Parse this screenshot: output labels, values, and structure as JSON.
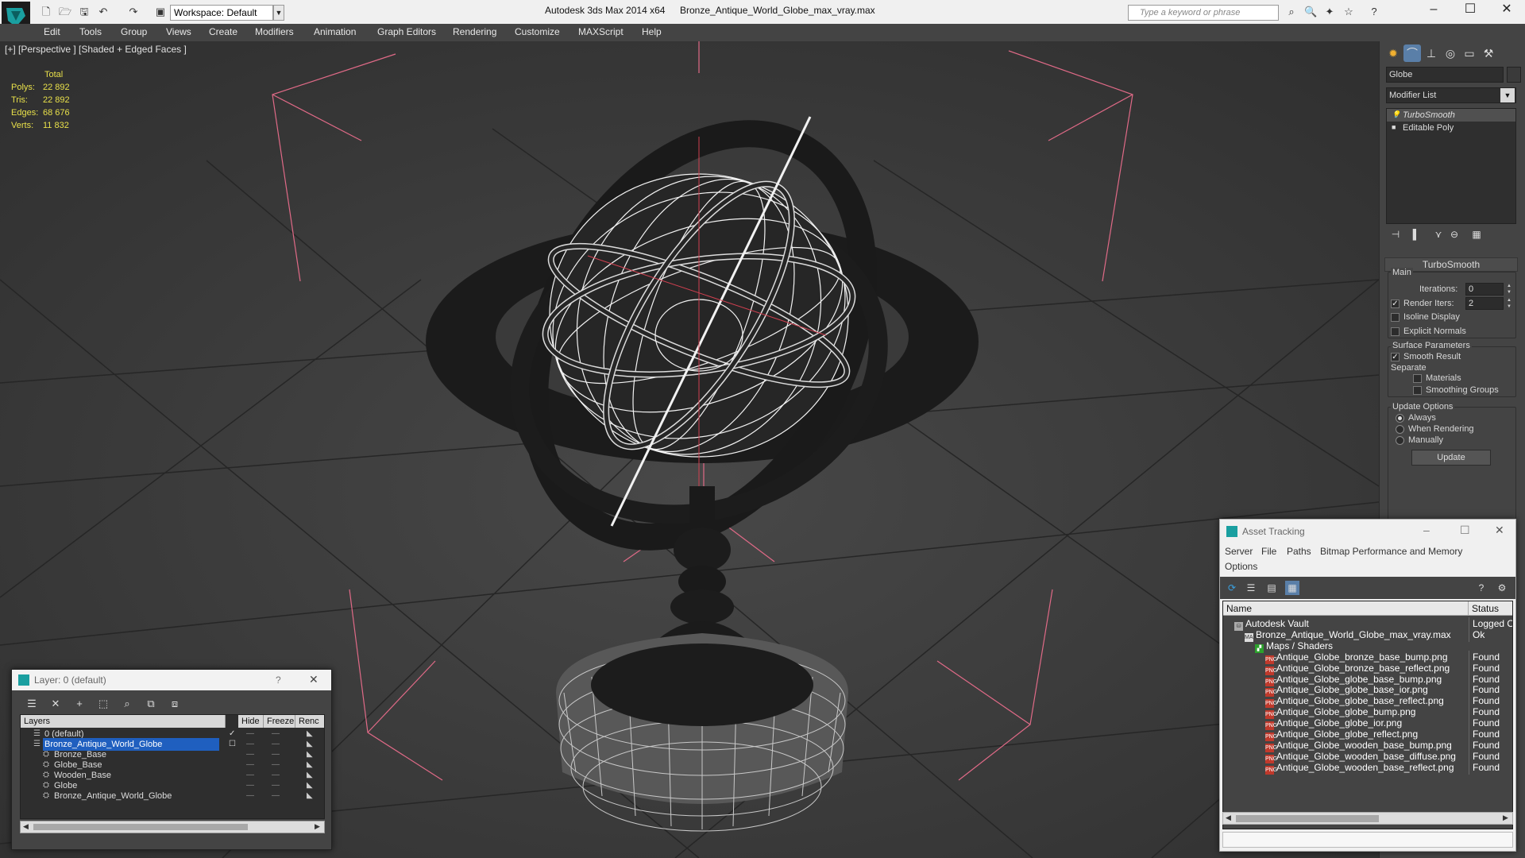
{
  "titlebar": {
    "workspace": "Workspace: Default",
    "app_title": "Autodesk 3ds Max  2014 x64",
    "file_title": "Bronze_Antique_World_Globe_max_vray.max",
    "search_placeholder": "Type a keyword or phrase"
  },
  "menu": [
    "Edit",
    "Tools",
    "Group",
    "Views",
    "Create",
    "Modifiers",
    "Animation",
    "Graph Editors",
    "Rendering",
    "Customize",
    "MAXScript",
    "Help"
  ],
  "viewport": {
    "label": "[+] [Perspective ] [Shaded + Edged Faces ]",
    "stats": {
      "header": "Total",
      "rows": [
        {
          "label": "Polys:",
          "value": "22 892"
        },
        {
          "label": "Tris:",
          "value": "22 892"
        },
        {
          "label": "Edges:",
          "value": "68 676"
        },
        {
          "label": "Verts:",
          "value": "11 832"
        }
      ]
    }
  },
  "command_panel": {
    "object_name": "Globe",
    "modifier_list": "Modifier List",
    "stack": [
      "TurboSmooth",
      "Editable Poly"
    ],
    "rollout": "TurboSmooth",
    "main_label": "Main",
    "iterations_label": "Iterations:",
    "iterations": "0",
    "render_iters_label": "Render Iters:",
    "render_iters": "2",
    "isoline": "Isoline Display",
    "explicit_normals": "Explicit Normals",
    "surface_params": "Surface Parameters",
    "smooth_result": "Smooth Result",
    "separate": "Separate",
    "materials": "Materials",
    "smoothing_groups": "Smoothing Groups",
    "update_options": "Update Options",
    "always": "Always",
    "when_rendering": "When Rendering",
    "manually": "Manually",
    "update_button": "Update"
  },
  "layer_dialog": {
    "title": "Layer: 0 (default)",
    "help": "?",
    "columns": [
      "Layers",
      "Hide",
      "Freeze",
      "Renc"
    ],
    "rows": [
      {
        "name": "0 (default)",
        "indent": 1,
        "selected": false
      },
      {
        "name": "Bronze_Antique_World_Globe",
        "indent": 1,
        "selected": true
      },
      {
        "name": "Bronze_Base",
        "indent": 2,
        "selected": false
      },
      {
        "name": "Globe_Base",
        "indent": 2,
        "selected": false
      },
      {
        "name": "Wooden_Base",
        "indent": 2,
        "selected": false
      },
      {
        "name": "Globe",
        "indent": 2,
        "selected": false
      },
      {
        "name": "Bronze_Antique_World_Globe",
        "indent": 2,
        "selected": false
      }
    ]
  },
  "asset_tracking": {
    "title": "Asset Tracking",
    "menu": [
      "Server",
      "File",
      "Paths",
      "Bitmap Performance and Memory",
      "Options"
    ],
    "columns": [
      "Name",
      "Status"
    ],
    "rows": [
      {
        "name": "Autodesk Vault",
        "status": "Logged O",
        "icon": "vault",
        "indent": 1
      },
      {
        "name": "Bronze_Antique_World_Globe_max_vray.max",
        "status": "Ok",
        "icon": "max",
        "indent": 2
      },
      {
        "name": "Maps / Shaders",
        "status": "",
        "icon": "map",
        "indent": 3
      },
      {
        "name": "Antique_Globe_bronze_base_bump.png",
        "status": "Found",
        "icon": "png",
        "indent": 4
      },
      {
        "name": "Antique_Globe_bronze_base_reflect.png",
        "status": "Found",
        "icon": "png",
        "indent": 4
      },
      {
        "name": "Antique_Globe_globe_base_bump.png",
        "status": "Found",
        "icon": "png",
        "indent": 4
      },
      {
        "name": "Antique_Globe_globe_base_ior.png",
        "status": "Found",
        "icon": "png",
        "indent": 4
      },
      {
        "name": "Antique_Globe_globe_base_reflect.png",
        "status": "Found",
        "icon": "png",
        "indent": 4
      },
      {
        "name": "Antique_Globe_globe_bump.png",
        "status": "Found",
        "icon": "png",
        "indent": 4
      },
      {
        "name": "Antique_Globe_globe_ior.png",
        "status": "Found",
        "icon": "png",
        "indent": 4
      },
      {
        "name": "Antique_Globe_globe_reflect.png",
        "status": "Found",
        "icon": "png",
        "indent": 4
      },
      {
        "name": "Antique_Globe_wooden_base_bump.png",
        "status": "Found",
        "icon": "png",
        "indent": 4
      },
      {
        "name": "Antique_Globe_wooden_base_diffuse.png",
        "status": "Found",
        "icon": "png",
        "indent": 4
      },
      {
        "name": "Antique_Globe_wooden_base_reflect.png",
        "status": "Found",
        "icon": "png",
        "indent": 4
      }
    ]
  }
}
